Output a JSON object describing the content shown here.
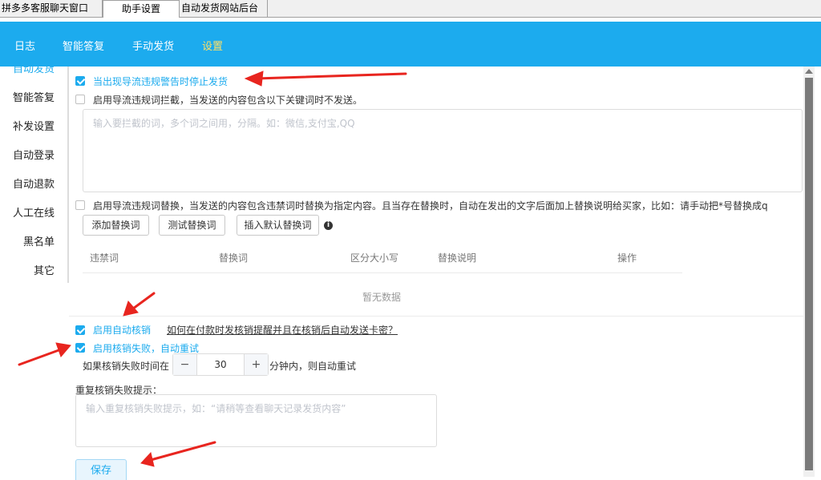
{
  "window_tabs": [
    "拼多多客服聊天窗口",
    "助手设置",
    "自动发货网站后台"
  ],
  "nav": {
    "items": [
      "日志",
      "智能答复",
      "手动发货",
      "设置"
    ],
    "active": "设置"
  },
  "sidebar": {
    "items": [
      "自动发货",
      "智能答复",
      "补发设置",
      "自动登录",
      "自动退款",
      "人工在线",
      "黑名单",
      "其它"
    ]
  },
  "settings": {
    "stop_on_warning": "当出现导流违规警告时停止发货",
    "intercept_label": "启用导流违规词拦截，当发送的内容包含以下关键词时不发送。",
    "intercept_placeholder": "输入要拦截的词，多个词之间用，分隔。如：微信,支付宝,QQ",
    "replace_label": "启用导流违规词替换，当发送的内容包含违禁词时替换为指定内容。且当存在替换时，自动在发出的文字后面加上替换说明给买家，比如：请手动把*号替换成q",
    "buttons": {
      "add": "添加替换词",
      "test": "测试替换词",
      "insert_default": "插入默认替换词"
    },
    "info_icon": "i",
    "table": {
      "headers": [
        "违禁词",
        "替换词",
        "区分大小写",
        "替换说明",
        "操作"
      ],
      "empty": "暂无数据"
    },
    "auto_verify": "启用自动核销",
    "auto_verify_link": "如何在付款时发核销提醒并且在核销后自动发送卡密？",
    "retry_label": "启用核销失败，自动重试",
    "retry_prefix": "如果核销失败时间在",
    "retry_value": "30",
    "retry_suffix": "分钟内，则自动重试",
    "retry_tip_label": "重复核销失败提示：",
    "retry_tip_placeholder": "输入重复核销失败提示，如：“请稍等查看聊天记录发货内容”",
    "save": "保存"
  },
  "colors": {
    "accent": "#1cabee",
    "arrow": "#e8251f"
  }
}
